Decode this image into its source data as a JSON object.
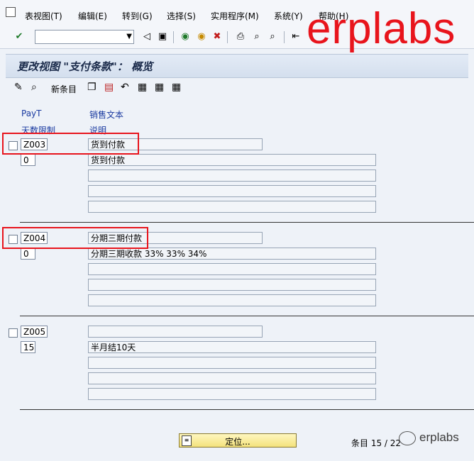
{
  "menu": [
    "表视图(T)",
    "编辑(E)",
    "转到(G)",
    "选择(S)",
    "实用程序(M)",
    "系统(Y)",
    "帮助(H)"
  ],
  "watermark": "erplabs",
  "title": "更改视图 \"支付条款\"： 概览",
  "app_toolbar": {
    "new_entries": "新条目"
  },
  "headers": {
    "payt": "PayT",
    "sales_text": "销售文本",
    "days_limit": "天数限制",
    "explanation": "说明"
  },
  "entries": [
    {
      "key": "Z003",
      "sales_text": "货到付款",
      "days": "0",
      "explanation": [
        "货到付款",
        "",
        "",
        ""
      ]
    },
    {
      "key": "Z004",
      "sales_text": "分期三期付款",
      "days": "0",
      "explanation": [
        "分期三期收款 33% 33% 34%",
        "",
        "",
        ""
      ]
    },
    {
      "key": "Z005",
      "sales_text": "",
      "days": "15",
      "explanation": [
        "半月结10天",
        "",
        "",
        ""
      ]
    }
  ],
  "bottom": {
    "position_button": "定位...",
    "entry_counter": "条目 15 / 22",
    "watermark": "erplabs"
  },
  "colors": {
    "highlight": "#e8141c",
    "header_text": "#1a3aa0",
    "position_button": "#f3e27c"
  }
}
